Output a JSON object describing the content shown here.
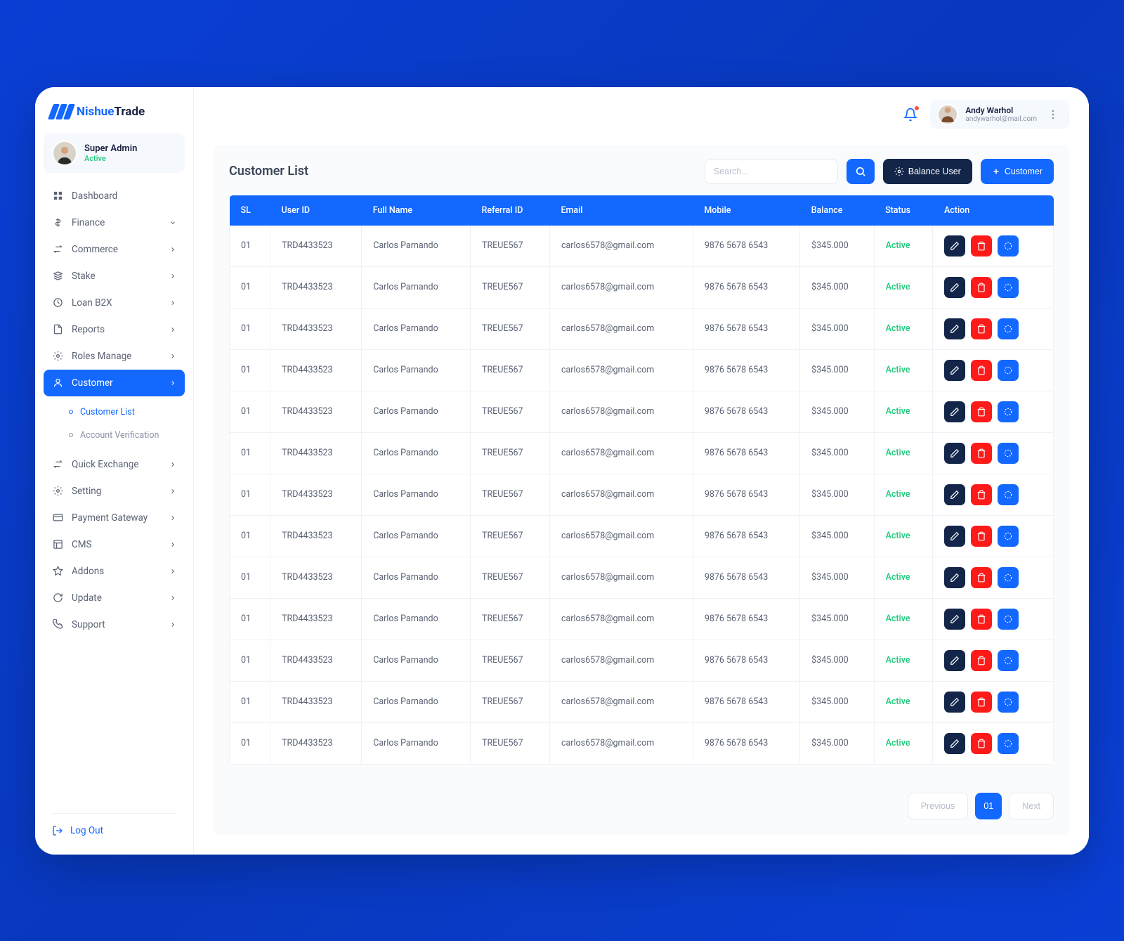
{
  "brand": {
    "name1": "Nishue",
    "name2": "Trade"
  },
  "sidebar": {
    "profile": {
      "name": "Super Admin",
      "status": "Active"
    },
    "items": [
      {
        "icon": "grid",
        "label": "Dashboard",
        "chev": false
      },
      {
        "icon": "money",
        "label": "Finance",
        "chev": true
      },
      {
        "icon": "swap",
        "label": "Commerce",
        "chev": true
      },
      {
        "icon": "stack",
        "label": "Stake",
        "chev": true
      },
      {
        "icon": "loan",
        "label": "Loan B2X",
        "chev": true
      },
      {
        "icon": "doc",
        "label": "Reports",
        "chev": true
      },
      {
        "icon": "gear",
        "label": "Roles Manage",
        "chev": true
      },
      {
        "icon": "user",
        "label": "Customer",
        "chev": true,
        "active": true
      },
      {
        "icon": "swap",
        "label": "Quick Exchange",
        "chev": true
      },
      {
        "icon": "gear",
        "label": "Setting",
        "chev": true
      },
      {
        "icon": "card",
        "label": "Payment Gateway",
        "chev": true
      },
      {
        "icon": "cms",
        "label": "CMS",
        "chev": true
      },
      {
        "icon": "addon",
        "label": "Addons",
        "chev": true
      },
      {
        "icon": "update",
        "label": "Update",
        "chev": true
      },
      {
        "icon": "support",
        "label": "Support",
        "chev": true
      }
    ],
    "sub": [
      {
        "label": "Customer List",
        "active": true
      },
      {
        "label": "Account Verification",
        "active": false
      }
    ],
    "logout": "Log Out"
  },
  "topbar": {
    "user": {
      "name": "Andy Warhol",
      "email": "andywarhol@mail.com"
    }
  },
  "page": {
    "title": "Customer List",
    "search_placeholder": "Search...",
    "balance_btn": "Balance User",
    "add_btn": "Customer",
    "columns": [
      "SL",
      "User ID",
      "Full Name",
      "Referral ID",
      "Email",
      "Mobile",
      "Balance",
      "Status",
      "Action"
    ],
    "rows": [
      {
        "sl": "01",
        "uid": "TRD4433523",
        "name": "Carlos Parnando",
        "ref": "TREUE567",
        "email": "carlos6578@gmail.com",
        "mobile": "9876 5678 6543",
        "bal": "$345.000",
        "status": "Active"
      },
      {
        "sl": "01",
        "uid": "TRD4433523",
        "name": "Carlos Parnando",
        "ref": "TREUE567",
        "email": "carlos6578@gmail.com",
        "mobile": "9876 5678 6543",
        "bal": "$345.000",
        "status": "Active"
      },
      {
        "sl": "01",
        "uid": "TRD4433523",
        "name": "Carlos Parnando",
        "ref": "TREUE567",
        "email": "carlos6578@gmail.com",
        "mobile": "9876 5678 6543",
        "bal": "$345.000",
        "status": "Active"
      },
      {
        "sl": "01",
        "uid": "TRD4433523",
        "name": "Carlos Parnando",
        "ref": "TREUE567",
        "email": "carlos6578@gmail.com",
        "mobile": "9876 5678 6543",
        "bal": "$345.000",
        "status": "Active"
      },
      {
        "sl": "01",
        "uid": "TRD4433523",
        "name": "Carlos Parnando",
        "ref": "TREUE567",
        "email": "carlos6578@gmail.com",
        "mobile": "9876 5678 6543",
        "bal": "$345.000",
        "status": "Active"
      },
      {
        "sl": "01",
        "uid": "TRD4433523",
        "name": "Carlos Parnando",
        "ref": "TREUE567",
        "email": "carlos6578@gmail.com",
        "mobile": "9876 5678 6543",
        "bal": "$345.000",
        "status": "Active"
      },
      {
        "sl": "01",
        "uid": "TRD4433523",
        "name": "Carlos Parnando",
        "ref": "TREUE567",
        "email": "carlos6578@gmail.com",
        "mobile": "9876 5678 6543",
        "bal": "$345.000",
        "status": "Active"
      },
      {
        "sl": "01",
        "uid": "TRD4433523",
        "name": "Carlos Parnando",
        "ref": "TREUE567",
        "email": "carlos6578@gmail.com",
        "mobile": "9876 5678 6543",
        "bal": "$345.000",
        "status": "Active"
      },
      {
        "sl": "01",
        "uid": "TRD4433523",
        "name": "Carlos Parnando",
        "ref": "TREUE567",
        "email": "carlos6578@gmail.com",
        "mobile": "9876 5678 6543",
        "bal": "$345.000",
        "status": "Active"
      },
      {
        "sl": "01",
        "uid": "TRD4433523",
        "name": "Carlos Parnando",
        "ref": "TREUE567",
        "email": "carlos6578@gmail.com",
        "mobile": "9876 5678 6543",
        "bal": "$345.000",
        "status": "Active"
      },
      {
        "sl": "01",
        "uid": "TRD4433523",
        "name": "Carlos Parnando",
        "ref": "TREUE567",
        "email": "carlos6578@gmail.com",
        "mobile": "9876 5678 6543",
        "bal": "$345.000",
        "status": "Active"
      },
      {
        "sl": "01",
        "uid": "TRD4433523",
        "name": "Carlos Parnando",
        "ref": "TREUE567",
        "email": "carlos6578@gmail.com",
        "mobile": "9876 5678 6543",
        "bal": "$345.000",
        "status": "Active"
      },
      {
        "sl": "01",
        "uid": "TRD4433523",
        "name": "Carlos Parnando",
        "ref": "TREUE567",
        "email": "carlos6578@gmail.com",
        "mobile": "9876 5678 6543",
        "bal": "$345.000",
        "status": "Active"
      }
    ],
    "pager": {
      "prev": "Previous",
      "current": "01",
      "next": "Next"
    }
  }
}
